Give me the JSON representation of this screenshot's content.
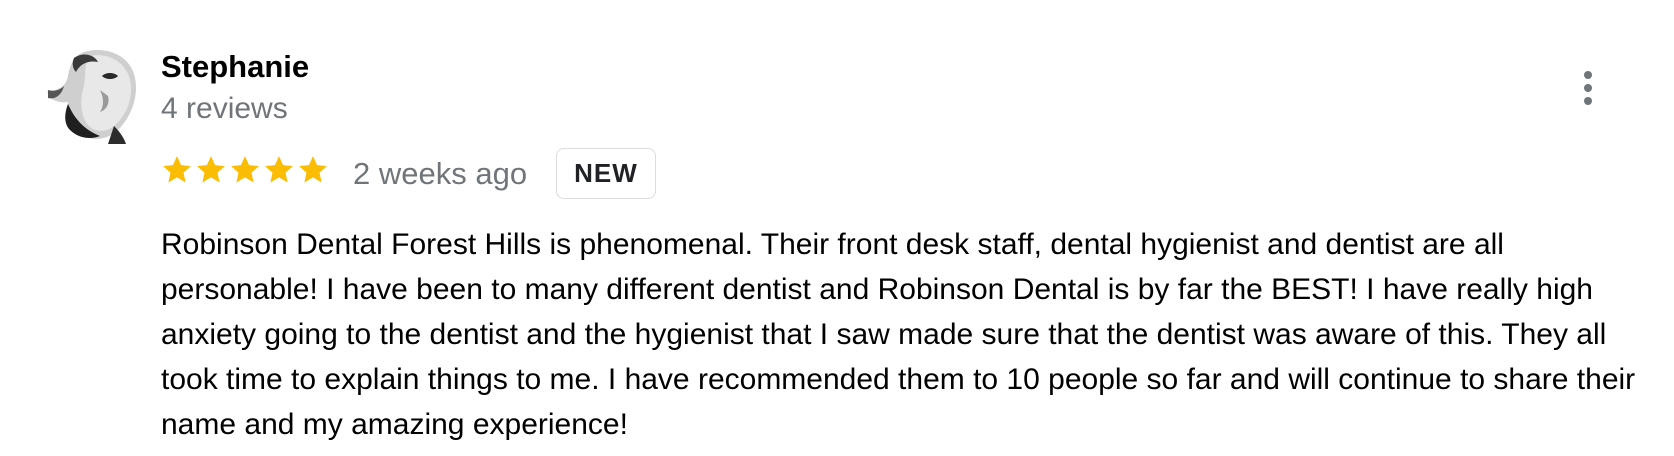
{
  "review": {
    "author": {
      "name": "Stephanie",
      "review_count": "4 reviews",
      "avatar_icon": "profile-photo"
    },
    "rating": {
      "stars": 5,
      "max_stars": 5,
      "star_color": "#fbbc04"
    },
    "date": "2 weeks ago",
    "badge": "NEW",
    "text": "Robinson Dental Forest Hills is phenomenal. Their front desk staff, dental hygienist and dentist are all personable! I have been to many different dentist and Robinson Dental is by far the BEST! I have really high anxiety going to the dentist and the hygienist that I saw made sure that the dentist was aware of this. They all took time to explain things to me. I have recommended them to 10 people so far and will continue to share their name and my amazing experience!",
    "menu_icon": "more-vert-icon"
  }
}
